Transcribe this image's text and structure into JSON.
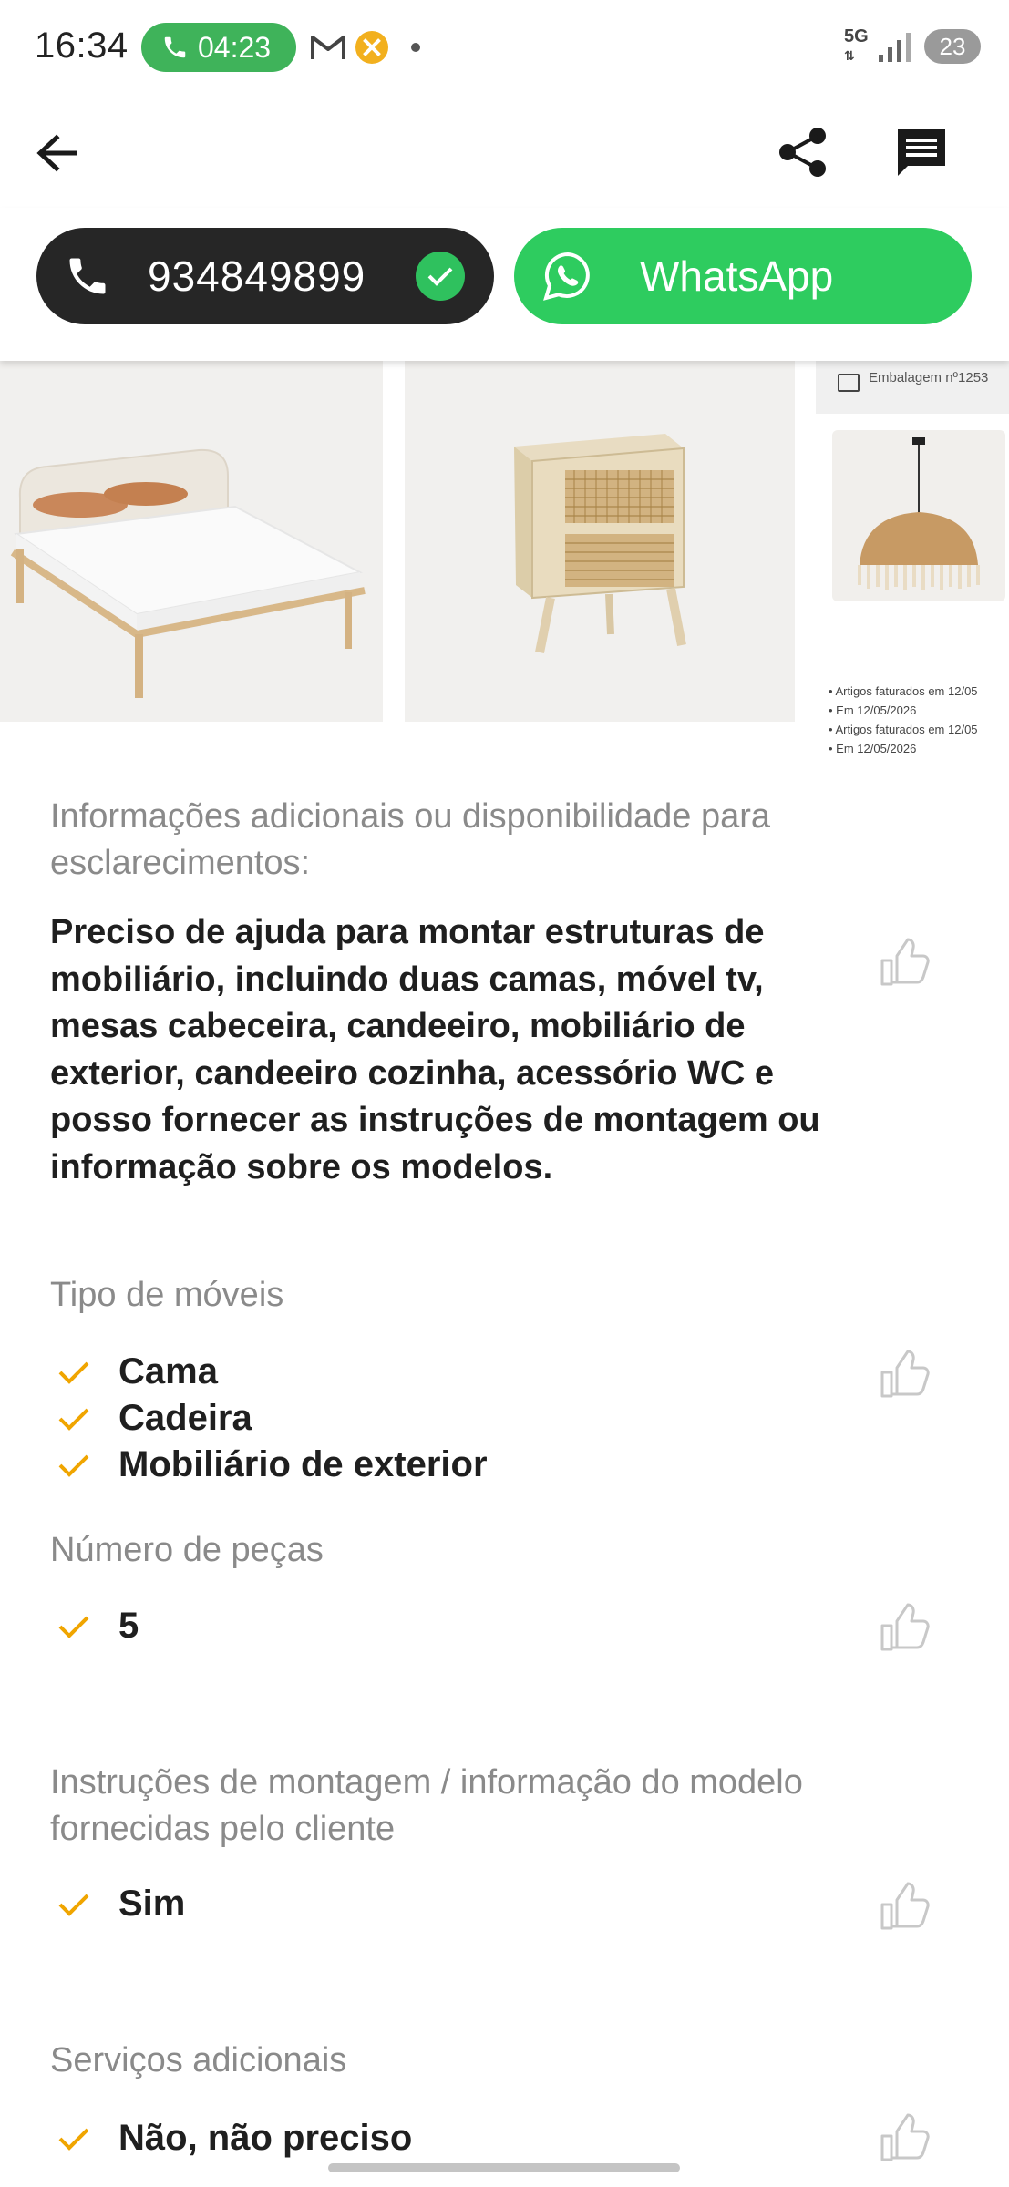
{
  "status_bar": {
    "time": "16:34",
    "call_timer": "04:23",
    "network": "5G",
    "battery": "23"
  },
  "top_bar": {
    "back_icon": "arrow-left-icon",
    "share_icon": "share-icon",
    "message_icon": "message-icon"
  },
  "contact": {
    "phone_number": "934849899",
    "whatsapp_label": "WhatsApp",
    "phone_color": "#262626",
    "whatsapp_color": "#2ecc5f"
  },
  "gallery": {
    "doc_header": "Embalagem nº1253",
    "doc_notes": [
      "• Artigos faturados em 12/05",
      "• Em 12/05/2026",
      "• Artigos faturados em 12/05",
      "• Em 12/05/2026"
    ]
  },
  "details": {
    "info_label": "Informações adicionais ou disponibilidade para esclarecimentos:",
    "info_text": "Preciso de ajuda para montar  estruturas de mobiliário, incluindo duas camas, móvel tv, mesas cabeceira, candeeiro, mobiliário de exterior, candeeiro cozinha, acessório WC e posso fornecer as instruções de montagem ou informação sobre os modelos.",
    "furniture_type_label": "Tipo de móveis",
    "furniture_types": [
      "Cama",
      "Cadeira",
      "Mobiliário de exterior"
    ],
    "pieces_label": "Número de peças",
    "pieces_value": "5",
    "instructions_label": "Instruções de montagem / informação do modelo fornecidas pelo cliente",
    "instructions_value": "Sim",
    "additional_services_label": "Serviços adicionais",
    "additional_services_value": "Não, não preciso"
  },
  "accent_color": "#f0a500"
}
